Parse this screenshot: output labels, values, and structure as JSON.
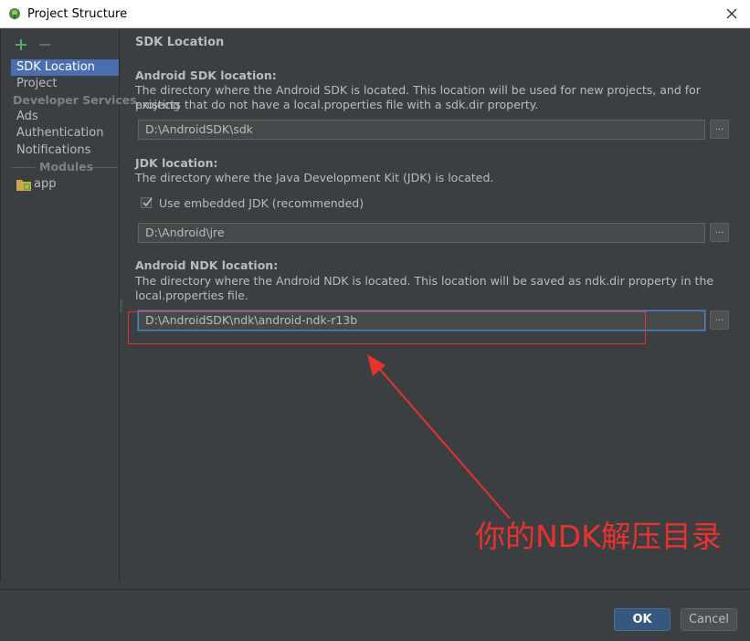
{
  "window": {
    "title": "Project Structure"
  },
  "sidebar": {
    "items": [
      {
        "label": "SDK Location",
        "selected": true
      },
      {
        "label": "Project"
      }
    ],
    "section_developer_services": "Developer Services",
    "developer_items": [
      {
        "label": "Ads"
      },
      {
        "label": "Authentication"
      },
      {
        "label": "Notifications"
      }
    ],
    "section_modules": "Modules",
    "modules": [
      {
        "label": "app"
      }
    ]
  },
  "content": {
    "section_title": "SDK Location",
    "sdk": {
      "label": "Android SDK location:",
      "description_line1": "The directory where the Android SDK is located. This location will be used for new projects, and for existing",
      "description_line2": "projects that do not have a local.properties file with a sdk.dir property.",
      "value": "D:\\AndroidSDK\\sdk"
    },
    "jdk": {
      "label": "JDK location:",
      "description": "The directory where the Java Development Kit (JDK) is located.",
      "checkbox_label": "Use embedded JDK (recommended)",
      "checkbox_checked": true,
      "value": "D:\\Android\\jre"
    },
    "ndk": {
      "label": "Android NDK location:",
      "description_line1": "The directory where the Android NDK is located. This location will be saved as ndk.dir property in the",
      "description_line2": "local.properties file.",
      "value": "D:\\AndroidSDK\\ndk\\android-ndk-r13b"
    },
    "browse_label": "..."
  },
  "annotation": {
    "text": "你的NDK解压目录",
    "color": "#e8322f"
  },
  "buttons": {
    "ok": "OK",
    "cancel": "Cancel"
  },
  "colors": {
    "background": "#3c3f41",
    "selection": "#4b6eaf",
    "focus": "#4a88c7",
    "ok_button": "#365880",
    "add_icon": "#59a869"
  }
}
